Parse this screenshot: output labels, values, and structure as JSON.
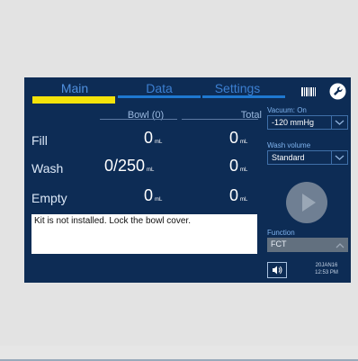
{
  "tabs": [
    {
      "label": "Main",
      "active": true
    },
    {
      "label": "Data",
      "active": false
    },
    {
      "label": "Settings",
      "active": false
    }
  ],
  "table": {
    "columns": [
      "Bowl (0)",
      "Total"
    ],
    "rows": [
      {
        "label": "Fill",
        "bowl": "0",
        "bowl_unit": "mL",
        "total": "0",
        "total_unit": "mL"
      },
      {
        "label": "Wash",
        "bowl": "0/250",
        "bowl_unit": "mL",
        "total": "0",
        "total_unit": "mL"
      },
      {
        "label": "Empty",
        "bowl": "0",
        "bowl_unit": "mL",
        "total": "0",
        "total_unit": "mL"
      }
    ]
  },
  "message": "Kit is not installed. Lock the bowl cover.",
  "vacuum": {
    "label": "Vacuum: On",
    "value": "-120 mmHg"
  },
  "wash_volume": {
    "label": "Wash volume",
    "value": "Standard"
  },
  "function": {
    "label": "Function",
    "value": "FCT"
  },
  "datetime": {
    "date": "20JAN16",
    "time": "12:53 PM"
  },
  "icons": [
    "barcode-icon",
    "wrench-icon",
    "play-icon",
    "speaker-icon",
    "chevron-down-icon",
    "chevron-up-icon"
  ],
  "colors": {
    "panel": "#0d2c55",
    "active_tab": "#f4e30a",
    "tab_text": "#3c7fd1",
    "accent_blue": "#1e78d0"
  }
}
